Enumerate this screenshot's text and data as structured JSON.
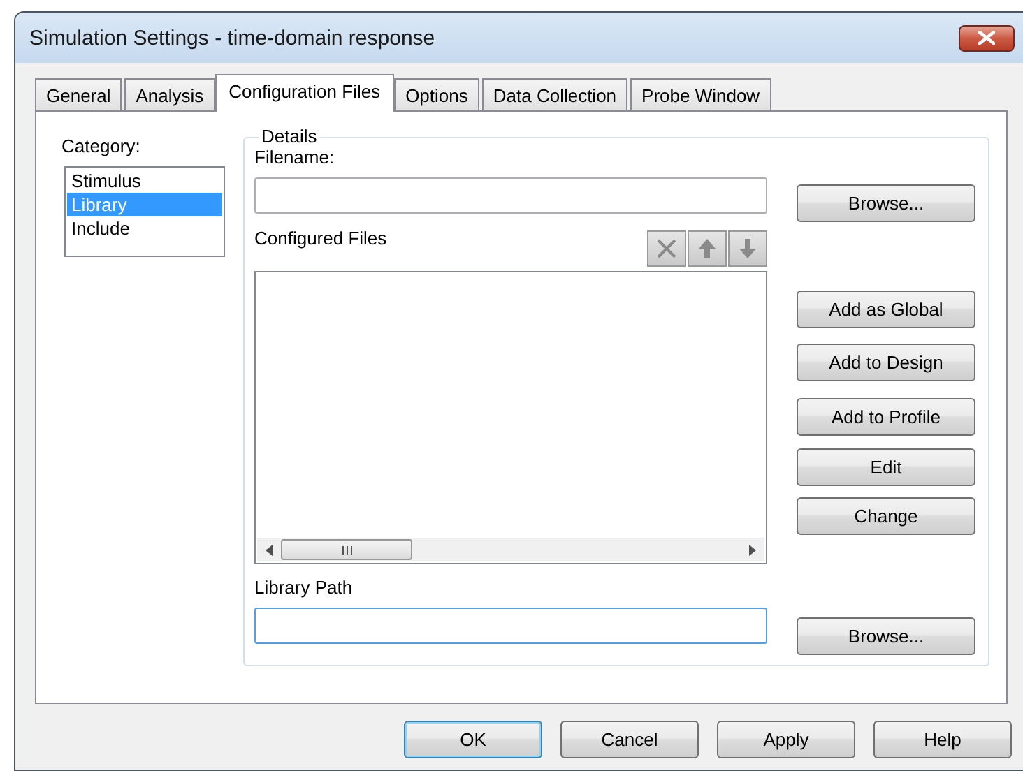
{
  "window": {
    "title": "Simulation Settings - time-domain response"
  },
  "tabs": [
    {
      "label": "General",
      "selected": false
    },
    {
      "label": "Analysis",
      "selected": false
    },
    {
      "label": "Configuration Files",
      "selected": true
    },
    {
      "label": "Options",
      "selected": false
    },
    {
      "label": "Data Collection",
      "selected": false
    },
    {
      "label": "Probe Window",
      "selected": false
    }
  ],
  "category": {
    "label": "Category:",
    "items": [
      {
        "label": "Stimulus",
        "selected": false
      },
      {
        "label": "Library",
        "selected": true
      },
      {
        "label": "Include",
        "selected": false
      }
    ]
  },
  "details": {
    "title": "Details",
    "filename": {
      "label": "Filename:",
      "focused": false,
      "button": "Browse..."
    },
    "configured_files": {
      "label": "Configured Files",
      "tools": [
        {
          "kind": "delete",
          "disabled": true
        },
        {
          "kind": "up",
          "disabled": true
        },
        {
          "kind": "down",
          "disabled": true
        }
      ],
      "buttons": [
        "Add as Global",
        "Add to Design",
        "Add to Profile",
        "Edit",
        "Change"
      ]
    },
    "library_path": {
      "label": "Library Path",
      "focused": true,
      "button": "Browse..."
    }
  },
  "buttons": [
    {
      "label": "OK",
      "default": true
    },
    {
      "label": "Cancel",
      "default": false
    },
    {
      "label": "Apply",
      "default": false
    },
    {
      "label": "Help",
      "default": false
    }
  ]
}
